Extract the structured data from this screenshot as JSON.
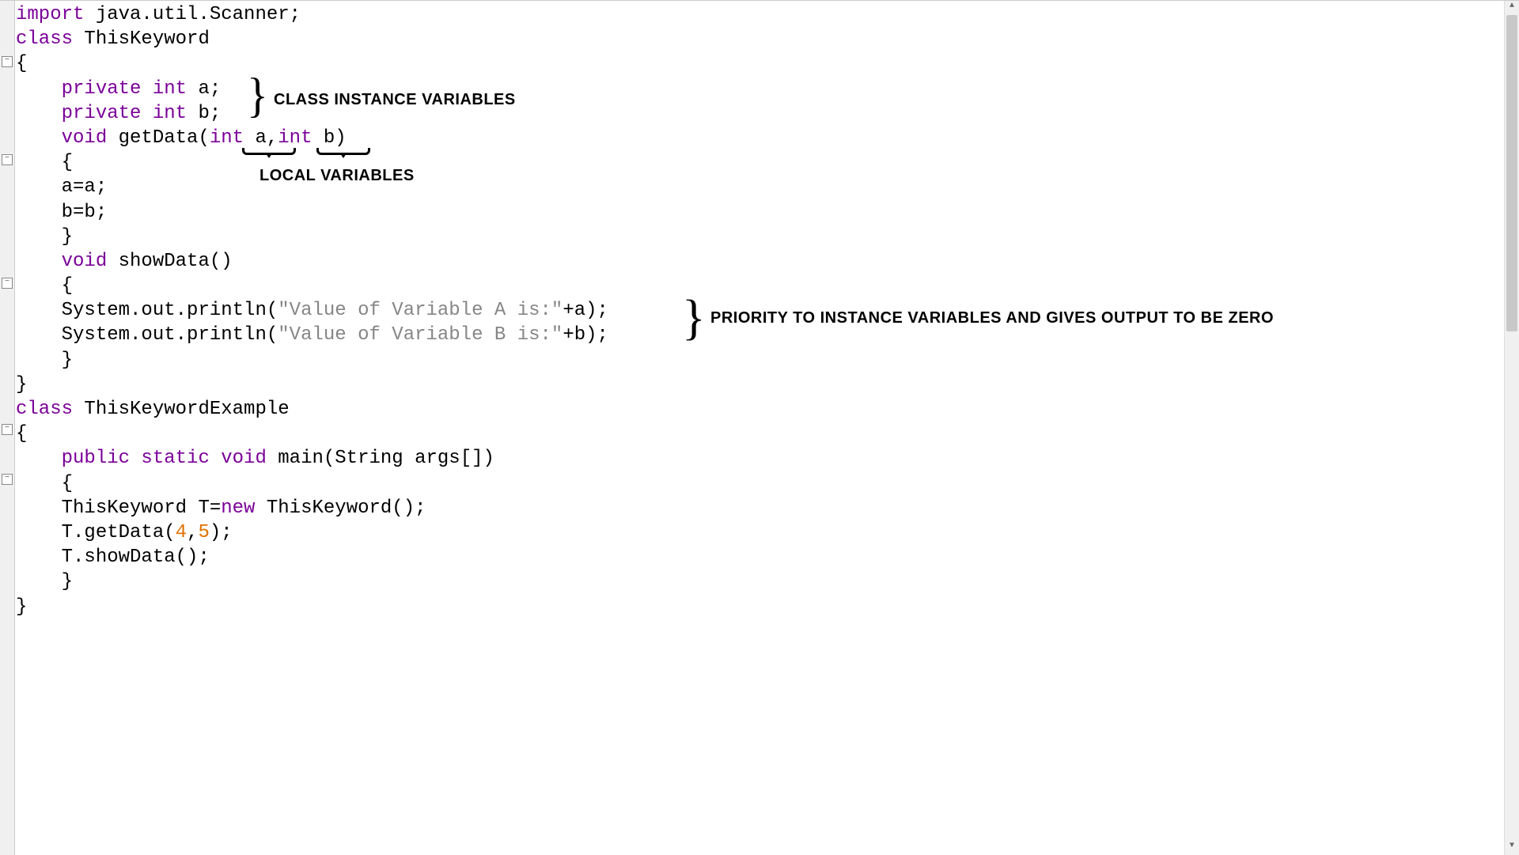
{
  "code": {
    "line1_import": "import",
    "line1_rest": " java.util.Scanner;",
    "line2_class": "class",
    "line2_name": " ThisKeyword",
    "line3": "{",
    "line4_pre": "    ",
    "line4_kw": "private int",
    "line4_rest": " a;",
    "line5_pre": "    ",
    "line5_kw": "private int",
    "line5_rest": " b;",
    "line6_pre": "    ",
    "line6_void": "void",
    "line6_mid": " getData(",
    "line6_int1": "int",
    "line6_a": " a,",
    "line6_int2": "int",
    "line6_b": " b)",
    "line7_pre": "    ",
    "line7": "{",
    "line8_pre": "    ",
    "line8": "a=a;",
    "line9_pre": "    ",
    "line9": "b=b;",
    "line10_pre": "    ",
    "line10": "}",
    "line11_pre": "    ",
    "line11_void": "void",
    "line11_rest": " showData()",
    "line12_pre": "    ",
    "line12": "{",
    "line13_pre": "    ",
    "line13_a": "System.out.println(",
    "line13_str": "\"Value of Variable A is:\"",
    "line13_b": "+a);",
    "line14_pre": "    ",
    "line14_a": "System.out.println(",
    "line14_str": "\"Value of Variable B is:\"",
    "line14_b": "+b);",
    "line15_pre": "    ",
    "line15": "}",
    "line16": "}",
    "line17_class": "class",
    "line17_name": " ThisKeywordExample",
    "line18": "{",
    "line19_pre": "    ",
    "line19_kw": "public static void",
    "line19_rest": " main(String args[])",
    "line20_pre": "    ",
    "line20": "{",
    "line21_pre": "    ",
    "line21_a": "ThisKeyword T=",
    "line21_new": "new",
    "line21_b": " ThisKeyword();",
    "line22_pre": "    ",
    "line22_a": "T.getData(",
    "line22_n1": "4",
    "line22_c": ",",
    "line22_n2": "5",
    "line22_b": ");",
    "line23_pre": "    ",
    "line23": "T.showData();",
    "line24_pre": "    ",
    "line24": "}",
    "line25": "}"
  },
  "annotations": {
    "class_instance": "CLASS INSTANCE VARIABLES",
    "local_vars": "LOCAL VARIABLES",
    "priority": "PRIORITY TO INSTANCE VARIABLES AND GIVES OUTPUT TO BE ZERO"
  }
}
